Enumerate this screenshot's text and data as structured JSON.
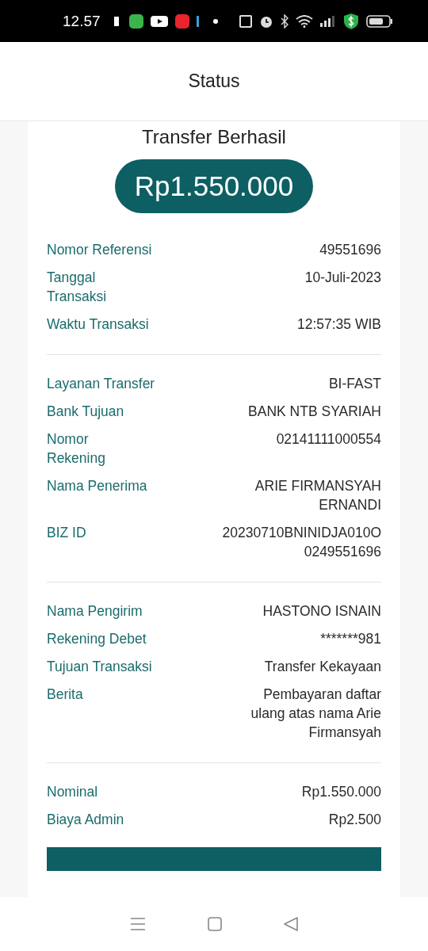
{
  "status_bar": {
    "time": "12.57"
  },
  "header": {
    "title": "Status"
  },
  "receipt": {
    "heading": "Transfer Berhasil",
    "amount": "Rp1.550.000",
    "sections": [
      {
        "rows": [
          {
            "label": "Nomor Referensi",
            "value": "49551696"
          },
          {
            "label": "Tanggal\nTransaksi",
            "value": "10-Juli-2023"
          },
          {
            "label": "Waktu Transaksi",
            "value": "12:57:35 WIB"
          }
        ]
      },
      {
        "rows": [
          {
            "label": "Layanan Transfer",
            "value": "BI-FAST"
          },
          {
            "label": "Bank Tujuan",
            "value": "BANK NTB SYARIAH"
          },
          {
            "label": "Nomor\nRekening",
            "value": "02141111000554"
          },
          {
            "label": "Nama Penerima",
            "value": "ARIE FIRMANSYAH\nERNANDI"
          },
          {
            "label": "BIZ ID",
            "value": "20230710BNINIDJA010O\n0249551696"
          }
        ]
      },
      {
        "rows": [
          {
            "label": "Nama Pengirim",
            "value": "HASTONO ISNAIN"
          },
          {
            "label": "Rekening Debet",
            "value": "*******981"
          },
          {
            "label": "Tujuan Transaksi",
            "value": "Transfer Kekayaan"
          },
          {
            "label": "Berita",
            "value": "Pembayaran daftar\nulang atas nama Arie\nFirmansyah"
          }
        ]
      },
      {
        "rows": [
          {
            "label": "Nominal",
            "value": "Rp1.550.000"
          },
          {
            "label": "Biaya Admin",
            "value": "Rp2.500"
          }
        ]
      }
    ]
  }
}
